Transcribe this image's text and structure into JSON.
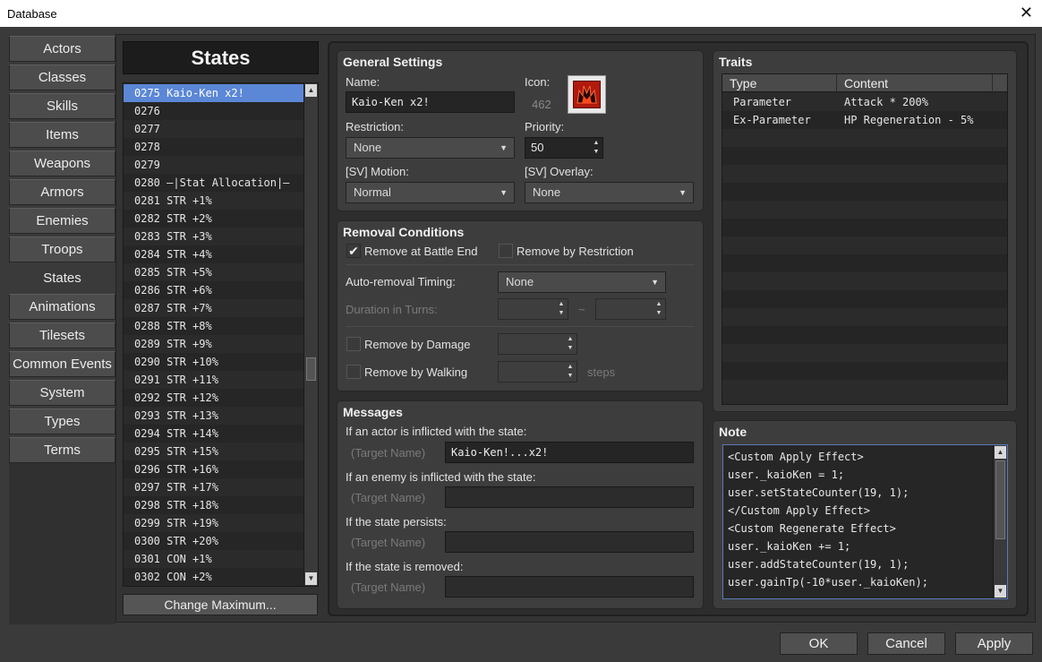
{
  "window": {
    "title": "Database",
    "close_glyph": "✕"
  },
  "categories": [
    "Actors",
    "Classes",
    "Skills",
    "Items",
    "Weapons",
    "Armors",
    "Enemies",
    "Troops",
    "States",
    "Animations",
    "Tilesets",
    "Common Events",
    "System",
    "Types",
    "Terms"
  ],
  "active_category": "States",
  "states_panel": {
    "header": "States",
    "items": [
      "0275 Kaio-Ken x2!",
      "0276",
      "0277",
      "0278",
      "0279",
      "0280 —|Stat Allocation|—",
      "0281 STR +1%",
      "0282 STR +2%",
      "0283 STR +3%",
      "0284 STR +4%",
      "0285 STR +5%",
      "0286 STR +6%",
      "0287 STR +7%",
      "0288 STR +8%",
      "0289 STR +9%",
      "0290 STR +10%",
      "0291 STR +11%",
      "0292 STR +12%",
      "0293 STR +13%",
      "0294 STR +14%",
      "0295 STR +15%",
      "0296 STR +16%",
      "0297 STR +17%",
      "0298 STR +18%",
      "0299 STR +19%",
      "0300 STR +20%",
      "0301 CON +1%",
      "0302 CON +2%"
    ],
    "selected_index": 0,
    "change_max_label": "Change Maximum..."
  },
  "general": {
    "title": "General Settings",
    "name_label": "Name:",
    "name_value": "Kaio-Ken x2!",
    "icon_label": "Icon:",
    "icon_index": "462",
    "restriction_label": "Restriction:",
    "restriction_value": "None",
    "priority_label": "Priority:",
    "priority_value": "50",
    "motion_label": "[SV] Motion:",
    "motion_value": "Normal",
    "overlay_label": "[SV] Overlay:",
    "overlay_value": "None"
  },
  "removal": {
    "title": "Removal Conditions",
    "battle_end_label": "Remove at Battle End",
    "battle_end_checked": true,
    "restriction_label": "Remove by Restriction",
    "restriction_checked": false,
    "auto_timing_label": "Auto-removal Timing:",
    "auto_timing_value": "None",
    "duration_label": "Duration in Turns:",
    "tilde": "~",
    "damage_label": "Remove by Damage",
    "walking_label": "Remove by Walking",
    "steps_label": "steps"
  },
  "messages": {
    "title": "Messages",
    "target_placeholder": "(Target Name)",
    "actor_label": "If an actor is inflicted with the state:",
    "actor_value": "Kaio-Ken!...x2!",
    "enemy_label": "If an enemy is inflicted with the state:",
    "enemy_value": "",
    "persists_label": "If the state persists:",
    "persists_value": "",
    "removed_label": "If the state is removed:",
    "removed_value": ""
  },
  "traits": {
    "title": "Traits",
    "col_type": "Type",
    "col_content": "Content",
    "rows": [
      {
        "type": "Parameter",
        "content": "Attack * 200%"
      },
      {
        "type": "Ex-Parameter",
        "content": "HP Regeneration - 5%"
      }
    ]
  },
  "note": {
    "title": "Note",
    "lines": [
      "<Custom Apply Effect>",
      "user._kaioKen = 1;",
      "user.setStateCounter(19, 1);",
      "</Custom Apply Effect>",
      "<Custom Regenerate Effect>",
      "user._kaioKen += 1;",
      "user.addStateCounter(19, 1);",
      "user.gainTp(-10*user._kaioKen);"
    ]
  },
  "dialog_buttons": {
    "ok": "OK",
    "cancel": "Cancel",
    "apply": "Apply"
  },
  "glyphs": {
    "caret_down": "▼",
    "caret_up": "▲",
    "spin_up": "▲",
    "spin_down": "▼",
    "check": "✔"
  },
  "colors": {
    "selection": "#5b87d6",
    "note_border": "#5a7ab8",
    "icon_red": "#b01a0c"
  }
}
